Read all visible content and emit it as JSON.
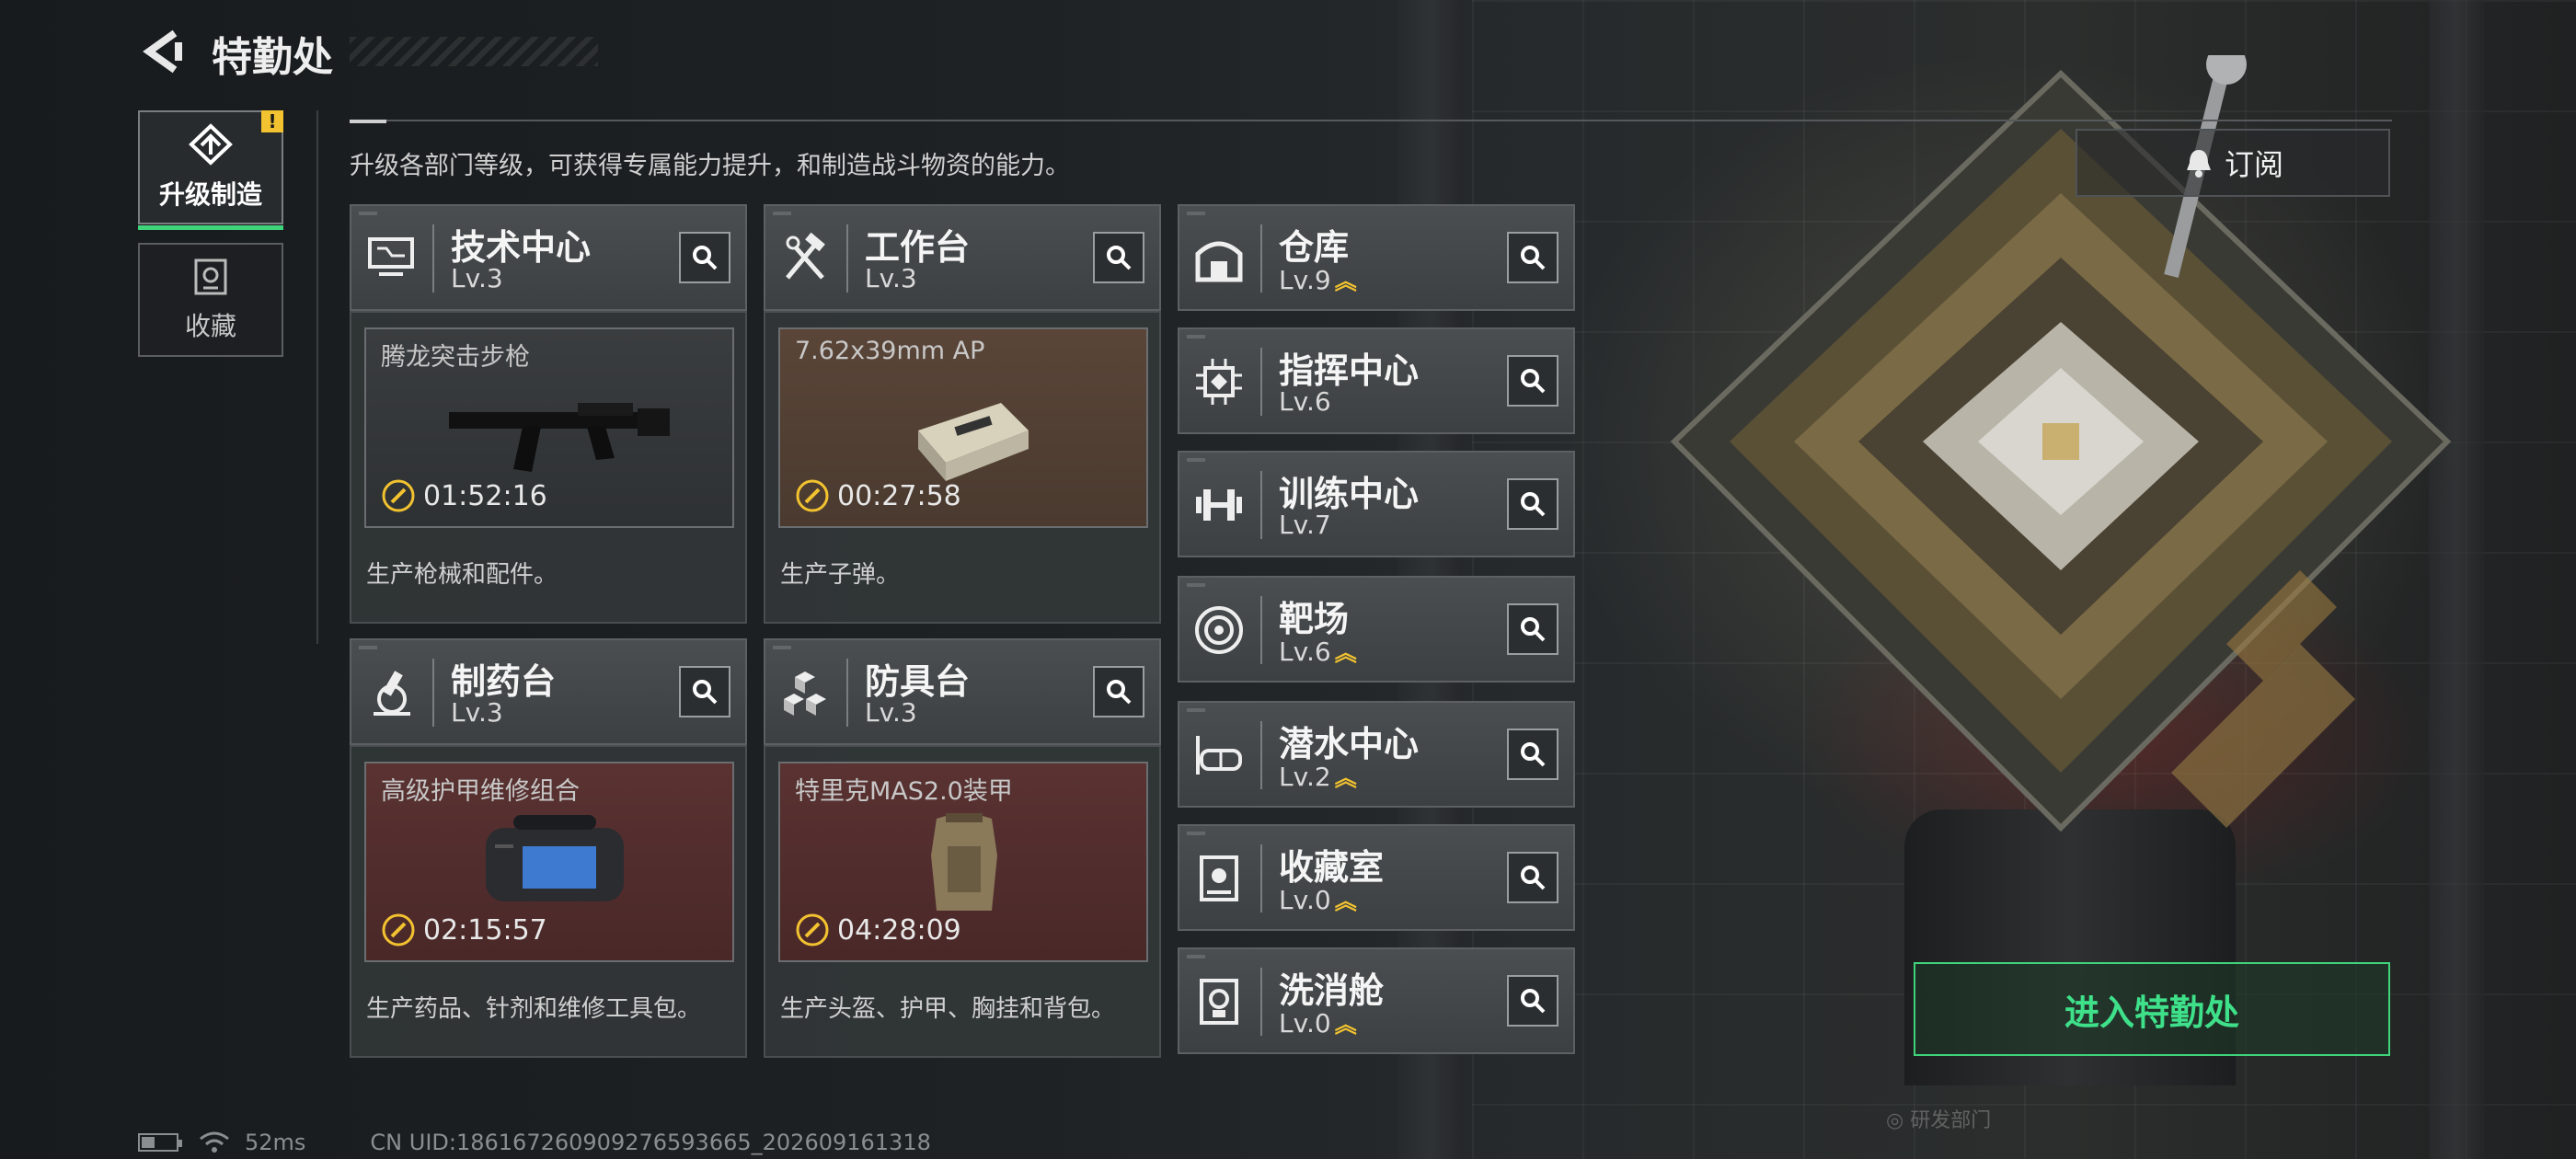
{
  "header": {
    "title": "特勤处"
  },
  "side_tabs": [
    {
      "label": "升级制造",
      "active": true,
      "badge": "!"
    },
    {
      "label": "收藏",
      "active": false
    }
  ],
  "description": "升级各部门等级，可获得专属能力提升，和制造战斗物资的能力。",
  "subscribe_label": "订阅",
  "facilities": {
    "tech_center": {
      "name": "技术中心",
      "level": "Lv.3"
    },
    "workbench": {
      "name": "工作台",
      "level": "Lv.3"
    },
    "pharmacy": {
      "name": "制药台",
      "level": "Lv.3"
    },
    "armor_bench": {
      "name": "防具台",
      "level": "Lv.3"
    },
    "warehouse": {
      "name": "仓库",
      "level": "Lv.9",
      "upgradable": true
    },
    "command_center": {
      "name": "指挥中心",
      "level": "Lv.6"
    },
    "training_center": {
      "name": "训练中心",
      "level": "Lv.7"
    },
    "shooting_range": {
      "name": "靶场",
      "level": "Lv.6",
      "upgradable": true
    },
    "diving_center": {
      "name": "潜水中心",
      "level": "Lv.2",
      "upgradable": true
    },
    "collection_room": {
      "name": "收藏室",
      "level": "Lv.0",
      "upgradable": true
    },
    "decon_chamber": {
      "name": "洗消舱",
      "level": "Lv.0",
      "upgradable": true
    }
  },
  "production": {
    "tech_center": {
      "item": "腾龙突击步枪",
      "timer": "01:52:16",
      "desc": "生产枪械和配件。"
    },
    "workbench": {
      "item": "7.62x39mm AP",
      "timer": "00:27:58",
      "desc": "生产子弹。"
    },
    "pharmacy": {
      "item": "高级护甲维修组合",
      "timer": "02:15:57",
      "desc": "生产药品、针剂和维修工具包。"
    },
    "armor_bench": {
      "item": "特里克MAS2.0装甲",
      "timer": "04:28:09",
      "desc": "生产头盔、护甲、胸挂和背包。"
    }
  },
  "enter_button": "进入特勤处",
  "status": {
    "ping": "52ms",
    "uid": "CN UID:1861672609092765936​65_202609161318"
  },
  "colors": {
    "accent_green": "#3fd47a",
    "upgrade_yellow": "#f2c230"
  }
}
